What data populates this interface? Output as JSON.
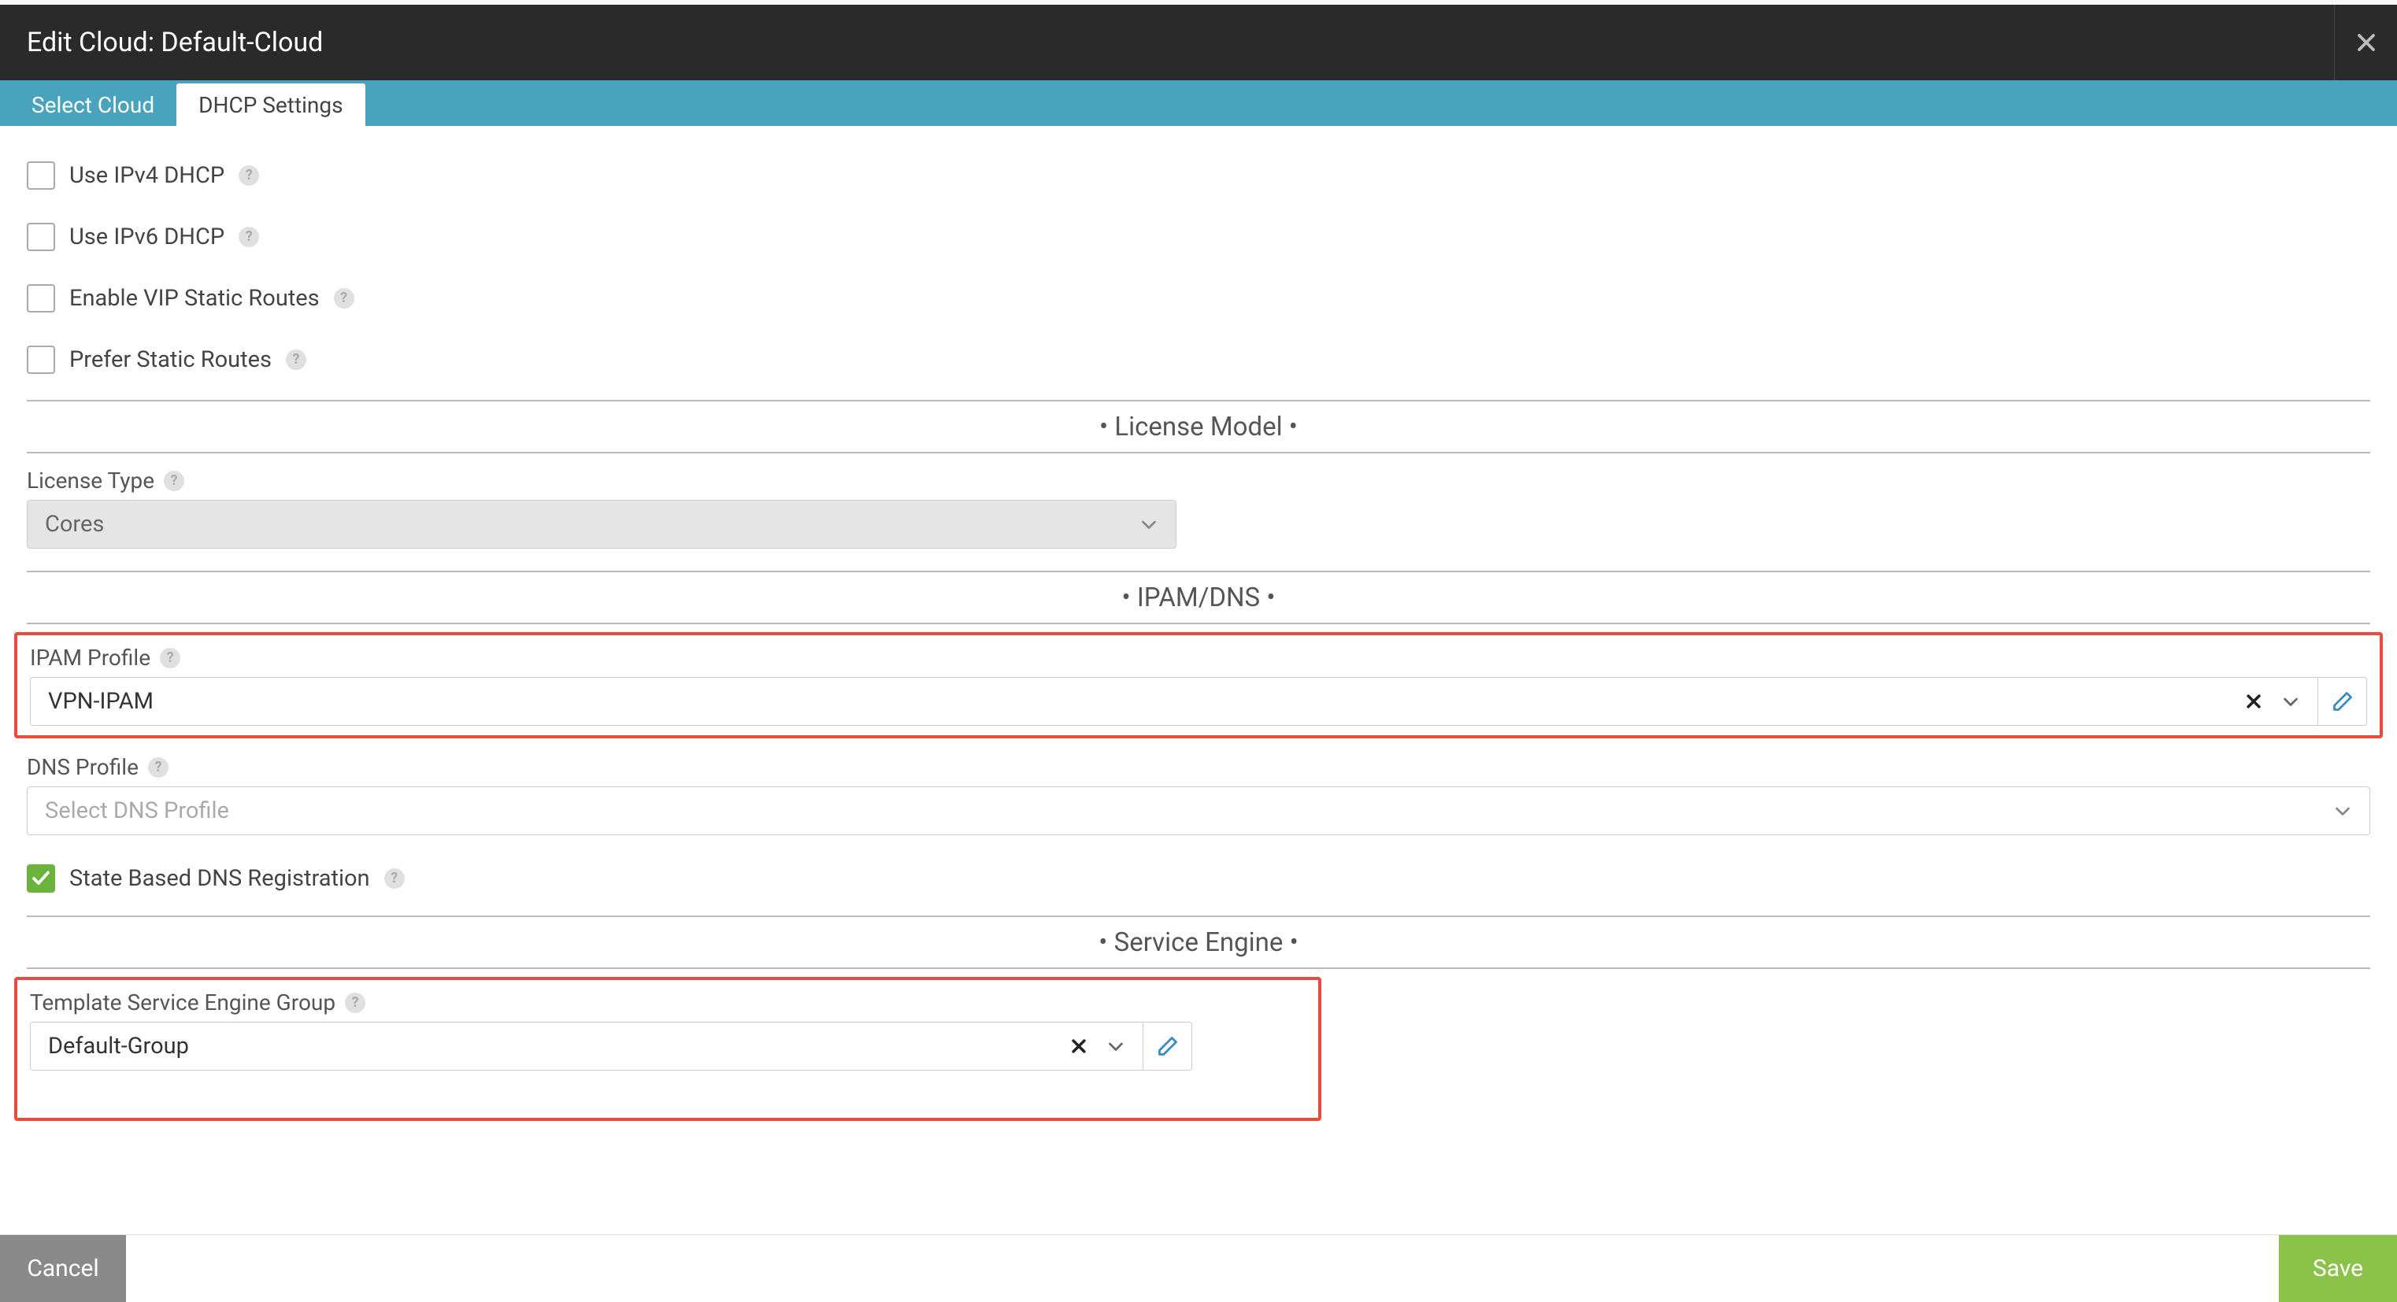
{
  "header": {
    "title": "Edit Cloud: Default-Cloud"
  },
  "tabs": {
    "select_cloud": "Select Cloud",
    "dhcp_settings": "DHCP Settings"
  },
  "checkboxes": {
    "use_ipv4": {
      "label": "Use IPv4 DHCP",
      "checked": false
    },
    "use_ipv6": {
      "label": "Use IPv6 DHCP",
      "checked": false
    },
    "vip_static": {
      "label": "Enable VIP Static Routes",
      "checked": false
    },
    "prefer_static": {
      "label": "Prefer Static Routes",
      "checked": false
    },
    "state_dns": {
      "label": "State Based DNS Registration",
      "checked": true
    }
  },
  "sections": {
    "license": "•  License Model  •",
    "ipam_dns": "•  IPAM/DNS  •",
    "service_engine": "•  Service Engine  •"
  },
  "license": {
    "label": "License Type",
    "value": "Cores"
  },
  "ipam": {
    "label": "IPAM Profile",
    "value": "VPN-IPAM"
  },
  "dns": {
    "label": "DNS Profile",
    "placeholder": "Select DNS Profile"
  },
  "se_group": {
    "label": "Template Service Engine Group",
    "value": "Default-Group"
  },
  "footer": {
    "cancel": "Cancel",
    "save": "Save"
  }
}
